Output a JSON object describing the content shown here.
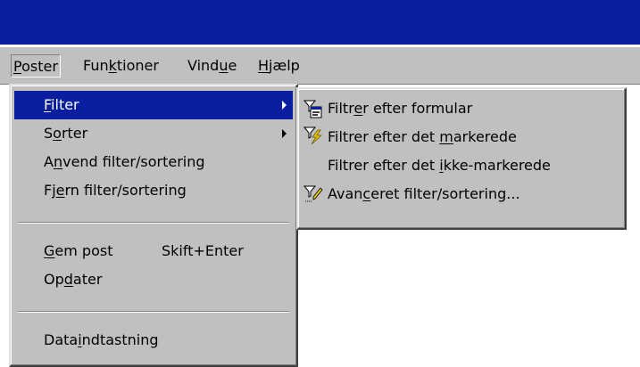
{
  "menubar": {
    "items": [
      {
        "pre": "",
        "key": "P",
        "post": "oster"
      },
      {
        "pre": "Fun",
        "key": "k",
        "post": "tioner"
      },
      {
        "pre": "Vind",
        "key": "u",
        "post": "e"
      },
      {
        "pre": "",
        "key": "H",
        "post": "jælp"
      }
    ]
  },
  "poster_menu": {
    "items": [
      {
        "pre": "",
        "key": "F",
        "post": "ilter"
      },
      {
        "pre": "S",
        "key": "o",
        "post": "rter"
      },
      {
        "pre": "A",
        "key": "n",
        "post": "vend filter/sortering"
      },
      {
        "pre": "Fj",
        "key": "e",
        "post": "rn filter/sortering"
      },
      {
        "pre": "",
        "key": "G",
        "post": "em post",
        "shortcut": "Skift+Enter"
      },
      {
        "pre": "Op",
        "key": "d",
        "post": "ater"
      },
      {
        "pre": "Data",
        "key": "i",
        "post": "ndtastning"
      }
    ]
  },
  "filter_submenu": {
    "items": [
      {
        "pre": "Filtr",
        "key": "e",
        "post": "r efter formular",
        "icon": "filter-form-icon"
      },
      {
        "pre": "Filtrer efter det ",
        "key": "m",
        "post": "arkerede",
        "icon": "filter-selection-icon"
      },
      {
        "pre": "Filtrer efter det ",
        "key": "i",
        "post": "kke-markerede",
        "icon": ""
      },
      {
        "pre": "Avan",
        "key": "c",
        "post": "eret filter/sortering...",
        "icon": "advanced-filter-icon"
      }
    ]
  },
  "colors": {
    "titlebar": "#0a1ea0",
    "menu_face": "#c0c0c0",
    "highlight": "#0a1ea0"
  }
}
